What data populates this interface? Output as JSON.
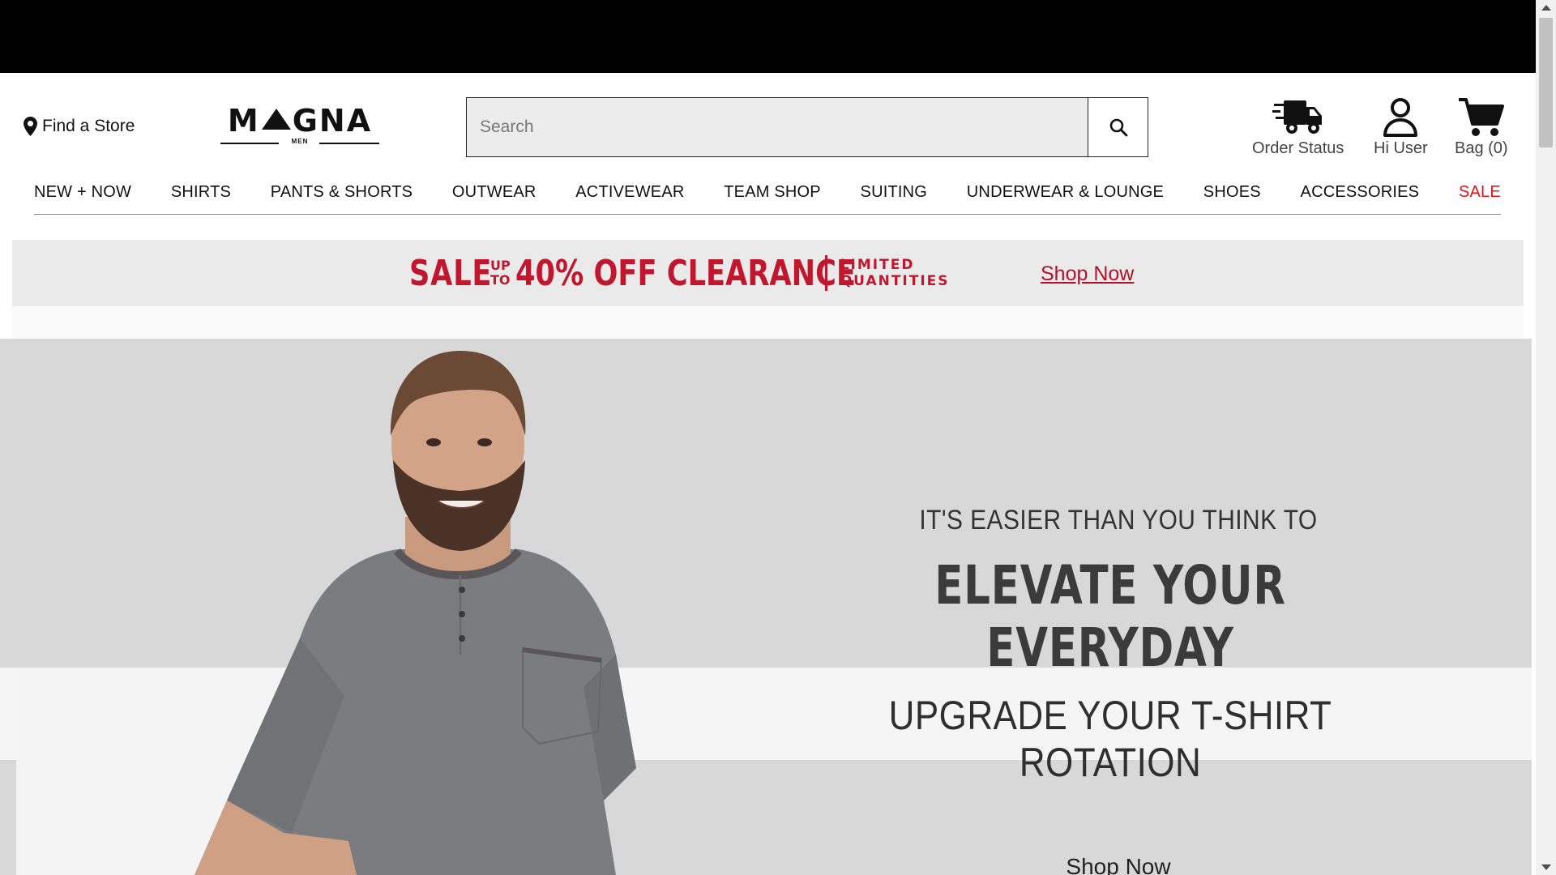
{
  "header": {
    "find_store": "Find a Store",
    "logo": {
      "wordmark_left": "M",
      "wordmark_right": "GNA",
      "sub": "MEN"
    },
    "search": {
      "placeholder": "Search",
      "value": ""
    },
    "order_status": "Order Status",
    "user": "Hi User",
    "bag": "Bag (0)"
  },
  "nav": {
    "items": [
      "NEW + NOW",
      "SHIRTS",
      "PANTS & SHORTS",
      "OUTWEAR",
      "ACTIVEWEAR",
      "TEAM SHOP",
      "SUITING",
      "UNDERWEAR & LOUNGE",
      "SHOES",
      "ACCESSORIES",
      "SALE"
    ]
  },
  "promo": {
    "sale": "SALE",
    "up": "UP",
    "to": "TO",
    "headline": "40% OFF CLEARANCE",
    "limited": "LIMITED",
    "quantities": "QUANTITIES",
    "shop_now": "Shop Now"
  },
  "hero": {
    "line1": "IT'S EASIER THAN YOU THINK TO",
    "line2": "ELEVATE YOUR EVERYDAY",
    "line3": "UPGRADE YOUR T-SHIRT ROTATION",
    "cta": "Shop Now"
  },
  "icons": {
    "find_store": "map-pin-icon",
    "search": "search-icon",
    "order_status": "delivery-truck-icon",
    "user": "user-icon",
    "bag": "shopping-cart-icon"
  },
  "colors": {
    "top_bar": "#000000",
    "accent_red": "#c0162e",
    "sale_red": "#e3141b",
    "promo_bg": "#eaeaea",
    "hero_bg": "#d8d8d9"
  }
}
